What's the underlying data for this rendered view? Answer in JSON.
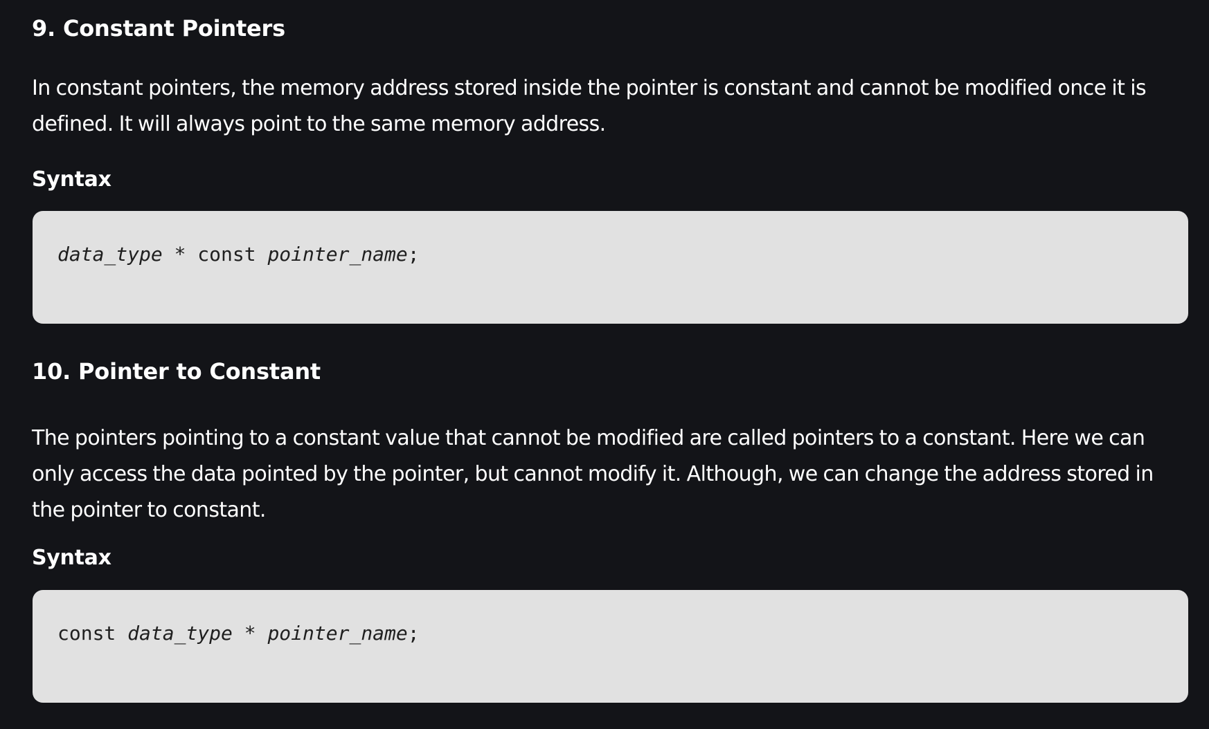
{
  "sections": [
    {
      "heading": "9. Constant Pointers",
      "paragraph_lines": [
        "In constant pointers, the memory address stored inside the pointer is constant and cannot be modified once it is",
        "defined. It will always point to the same memory address."
      ],
      "syntax_label": "Syntax",
      "code_tokens": [
        {
          "text": "data_type",
          "italic": true
        },
        {
          "text": " * ",
          "italic": false
        },
        {
          "text": "const",
          "italic": false
        },
        {
          "text": " ",
          "italic": false
        },
        {
          "text": "pointer_name",
          "italic": true
        },
        {
          "text": ";",
          "italic": false
        }
      ]
    },
    {
      "heading": "10. Pointer to Constant",
      "paragraph_lines": [
        "The pointers pointing to a constant value that cannot be modified are called pointers to a constant. Here we can",
        "only access the data pointed by the pointer, but cannot modify it. Although, we can change the address stored in",
        "the pointer to constant."
      ],
      "syntax_label": "Syntax",
      "code_tokens": [
        {
          "text": "const",
          "italic": false
        },
        {
          "text": " ",
          "italic": false
        },
        {
          "text": "data_type",
          "italic": true
        },
        {
          "text": " * ",
          "italic": false
        },
        {
          "text": "pointer_name",
          "italic": true
        },
        {
          "text": ";",
          "italic": false
        }
      ]
    }
  ],
  "colors": {
    "page_background": "#131418",
    "text": "#ffffff",
    "code_background": "#e1e1e1",
    "code_text": "#1f1f1f"
  }
}
